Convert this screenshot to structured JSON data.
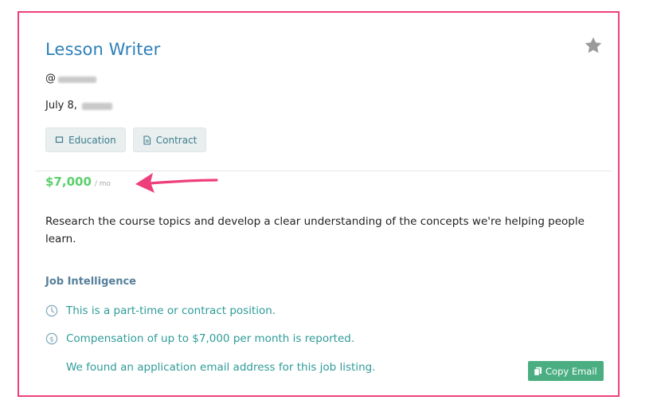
{
  "job": {
    "title": "Lesson Writer",
    "company_prefix": "@",
    "date_prefix": "July 8,",
    "tags": [
      {
        "label": "Education",
        "icon": "square-icon"
      },
      {
        "label": "Contract",
        "icon": "document-icon"
      }
    ],
    "salary": {
      "amount": "$7,000",
      "period": "/ mo"
    },
    "description": "Research the course topics and develop a clear understanding of the concepts we're helping people learn."
  },
  "intelligence": {
    "heading": "Job Intelligence",
    "items": [
      {
        "icon": "clock-icon",
        "text": "This is a part-time or contract position."
      },
      {
        "icon": "dollar-circle-icon",
        "text": "Compensation of up to $7,000 per month is reported."
      },
      {
        "icon": "",
        "text": "We found an application email address for this job listing."
      }
    ],
    "copy_button_label": "Copy Email"
  },
  "colors": {
    "card_border": "#ee3f7c",
    "title": "#2d7fb8",
    "salary": "#5ccf6b",
    "accent_teal": "#2e9b98",
    "button": "#4bae82",
    "annotation_arrow": "#ee3f7c"
  }
}
